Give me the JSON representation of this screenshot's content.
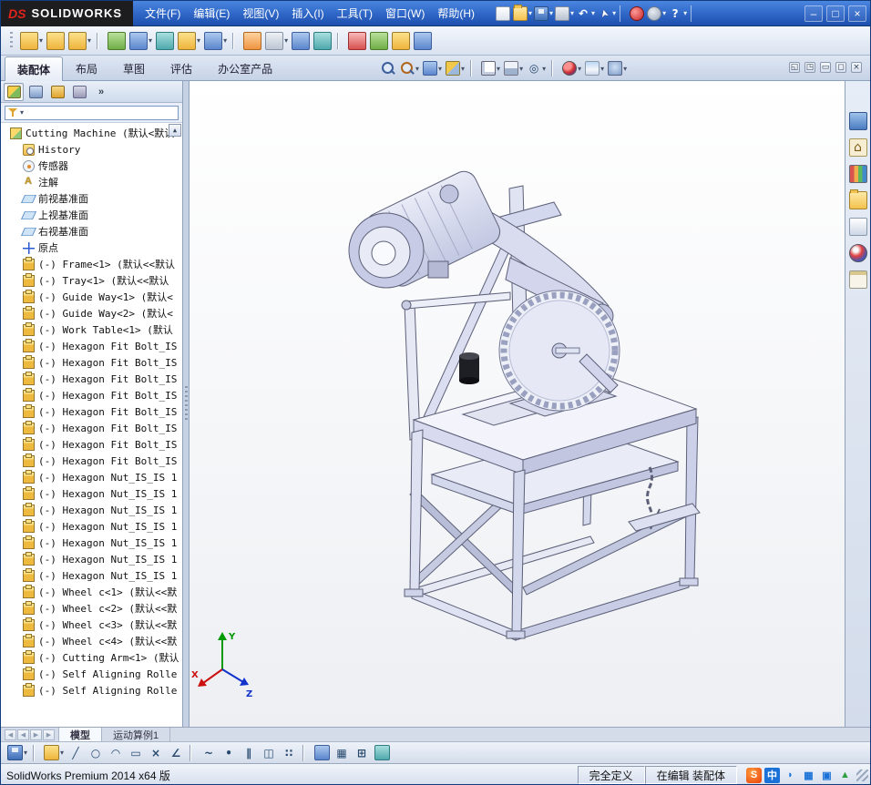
{
  "window": {
    "logo": {
      "ds": "DS",
      "name": "SOLIDWORKS"
    },
    "menus": [
      {
        "label": "文件(F)",
        "name": "menu-file"
      },
      {
        "label": "编辑(E)",
        "name": "menu-edit"
      },
      {
        "label": "视图(V)",
        "name": "menu-view"
      },
      {
        "label": "插入(I)",
        "name": "menu-insert"
      },
      {
        "label": "工具(T)",
        "name": "menu-tools"
      },
      {
        "label": "窗口(W)",
        "name": "menu-window"
      },
      {
        "label": "帮助(H)",
        "name": "menu-help"
      }
    ],
    "controls": [
      {
        "glyph": "–",
        "name": "minimize-button"
      },
      {
        "glyph": "□",
        "name": "maximize-button"
      },
      {
        "glyph": "×",
        "name": "close-button"
      }
    ]
  },
  "titlebar_tools": {
    "items": [
      {
        "kind": "doc",
        "name": "new-document-icon"
      },
      {
        "kind": "folder",
        "name": "open-document-icon",
        "caret": true
      },
      {
        "kind": "save",
        "name": "save-icon",
        "caret": true
      },
      {
        "kind": "print",
        "name": "print-icon",
        "caret": true
      },
      {
        "kind": "undo",
        "name": "undo-icon",
        "glyph": "↶",
        "caret": true
      },
      {
        "kind": "cursor",
        "name": "select-icon",
        "glyph": "➤",
        "caret": true
      },
      {
        "kind": "sep",
        "name": "separator",
        "inter": "false"
      },
      {
        "kind": "rebuild",
        "name": "rebuild-icon"
      },
      {
        "kind": "gear",
        "name": "options-icon",
        "caret": true
      },
      {
        "kind": "help",
        "name": "help-icon",
        "glyph": "?",
        "caret": true
      },
      {
        "kind": "sep",
        "name": "separator",
        "inter": "false"
      }
    ]
  },
  "toolbar2": {
    "items": [
      {
        "kind": "k-gold",
        "name": "insert-components-icon",
        "caret": true
      },
      {
        "kind": "k-gold",
        "name": "mate-icon"
      },
      {
        "kind": "k-gold",
        "name": "linear-component-pattern-icon",
        "caret": true
      },
      {
        "kind": "sep",
        "name": "separator",
        "inter": "false"
      },
      {
        "kind": "k-green",
        "name": "smart-fasteners-icon"
      },
      {
        "kind": "k-blue",
        "name": "move-component-icon",
        "caret": true
      },
      {
        "kind": "k-teal",
        "name": "show-hidden-components-icon"
      },
      {
        "kind": "k-gold",
        "name": "assembly-features-icon",
        "caret": true
      },
      {
        "kind": "k-blue",
        "name": "reference-geometry-icon",
        "caret": true
      },
      {
        "kind": "sep",
        "name": "separator",
        "inter": "false"
      },
      {
        "kind": "k-orange",
        "name": "new-motion-study-icon"
      },
      {
        "kind": "k-gray",
        "name": "bill-of-materials-icon",
        "caret": true
      },
      {
        "kind": "k-blue",
        "name": "exploded-view-icon"
      },
      {
        "kind": "k-teal",
        "name": "explode-line-sketch-icon"
      },
      {
        "kind": "sep",
        "name": "separator",
        "inter": "false"
      },
      {
        "kind": "k-red",
        "name": "interference-detection-icon"
      },
      {
        "kind": "k-green",
        "name": "assembly-xpert-icon"
      },
      {
        "kind": "k-gold",
        "name": "take-snapshot-icon"
      },
      {
        "kind": "k-blue",
        "name": "instant3d-icon"
      }
    ]
  },
  "command_tabs": {
    "items": [
      {
        "label": "装配体",
        "name": "tab-assembly",
        "active": "true"
      },
      {
        "label": "布局",
        "name": "tab-layout",
        "active": "false"
      },
      {
        "label": "草图",
        "name": "tab-sketch",
        "active": "false"
      },
      {
        "label": "评估",
        "name": "tab-evaluate",
        "active": "false"
      },
      {
        "label": "办公室产品",
        "name": "tab-office-products",
        "active": "false"
      }
    ]
  },
  "headsup": {
    "items": [
      {
        "kind": "mag",
        "name": "zoom-to-fit-icon"
      },
      {
        "kind": "magarea",
        "name": "zoom-to-area-icon",
        "caret": true
      },
      {
        "kind": "k-blue",
        "name": "previous-view-icon",
        "caret": true
      },
      {
        "kind": "section",
        "name": "section-view-icon",
        "caret": true
      },
      {
        "kind": "sep",
        "name": "separator",
        "inter": "false"
      },
      {
        "kind": "orient",
        "name": "view-orientation-icon",
        "caret": true
      },
      {
        "kind": "dstyle",
        "name": "display-style-icon",
        "caret": true
      },
      {
        "kind": "plain",
        "glyph": "◎",
        "name": "hide-show-items-icon",
        "caret": true
      },
      {
        "kind": "sep",
        "name": "separator",
        "inter": "false"
      },
      {
        "kind": "ball",
        "name": "edit-appearance-icon",
        "caret": true
      },
      {
        "kind": "scene",
        "name": "apply-scene-icon",
        "caret": true
      },
      {
        "kind": "vset",
        "name": "view-settings-icon",
        "caret": true
      }
    ]
  },
  "dock": {
    "items": [
      {
        "kind": "mini",
        "glyph": "◱",
        "name": "dock-pane-left-icon"
      },
      {
        "kind": "mini",
        "glyph": "◳",
        "name": "dock-pane-right-icon"
      },
      {
        "kind": "mini",
        "glyph": "▭",
        "name": "collapse-commandmanager-icon"
      },
      {
        "kind": "mini",
        "glyph": "◻",
        "name": "float-commandmanager-icon"
      },
      {
        "kind": "mini",
        "glyph": "×",
        "name": "close-commandmanager-icon"
      }
    ]
  },
  "panel": {
    "tabs": {
      "items": [
        {
          "kind": "pt-feature",
          "name": "featuremanager-tab",
          "active": "true"
        },
        {
          "kind": "pt-property",
          "name": "propertymanager-tab",
          "active": "false"
        },
        {
          "kind": "pt-config",
          "name": "configurationmanager-tab",
          "active": "false"
        },
        {
          "kind": "pt-dimxpert",
          "name": "dimxpertmanager-tab",
          "active": "false"
        }
      ]
    },
    "more_glyph": "»",
    "scroll_up_glyph": "▲",
    "tree": {
      "root": {
        "label": "Cutting Machine (默认<默认",
        "icon": "assembly-icon"
      },
      "items": [
        {
          "icon": "history-icon",
          "label": "History"
        },
        {
          "icon": "sensors-icon",
          "label": "传感器"
        },
        {
          "icon": "annotations-icon",
          "label": "注解"
        },
        {
          "icon": "plane-icon",
          "label": "前视基准面"
        },
        {
          "icon": "plane-icon",
          "label": "上视基准面"
        },
        {
          "icon": "plane-icon",
          "label": "右视基准面"
        },
        {
          "icon": "origin-icon",
          "label": "原点"
        },
        {
          "icon": "part-icon",
          "label": "(-) Frame<1> (默认<<默认"
        },
        {
          "icon": "part-icon",
          "label": "(-) Tray<1> (默认<<默认"
        },
        {
          "icon": "part-icon",
          "label": "(-) Guide Way<1> (默认<"
        },
        {
          "icon": "part-icon",
          "label": "(-) Guide Way<2> (默认<"
        },
        {
          "icon": "part-icon",
          "label": "(-) Work Table<1> (默认"
        },
        {
          "icon": "part-icon",
          "label": "(-) Hexagon Fit Bolt_IS"
        },
        {
          "icon": "part-icon",
          "label": "(-) Hexagon Fit Bolt_IS"
        },
        {
          "icon": "part-icon",
          "label": "(-) Hexagon Fit Bolt_IS"
        },
        {
          "icon": "part-icon",
          "label": "(-) Hexagon Fit Bolt_IS"
        },
        {
          "icon": "part-icon",
          "label": "(-) Hexagon Fit Bolt_IS"
        },
        {
          "icon": "part-icon",
          "label": "(-) Hexagon Fit Bolt_IS"
        },
        {
          "icon": "part-icon",
          "label": "(-) Hexagon Fit Bolt_IS"
        },
        {
          "icon": "part-icon",
          "label": "(-) Hexagon Fit Bolt_IS"
        },
        {
          "icon": "part-icon",
          "label": "(-) Hexagon Nut_IS_IS 1"
        },
        {
          "icon": "part-icon",
          "label": "(-) Hexagon Nut_IS_IS 1"
        },
        {
          "icon": "part-icon",
          "label": "(-) Hexagon Nut_IS_IS 1"
        },
        {
          "icon": "part-icon",
          "label": "(-) Hexagon Nut_IS_IS 1"
        },
        {
          "icon": "part-icon",
          "label": "(-) Hexagon Nut_IS_IS 1"
        },
        {
          "icon": "part-icon",
          "label": "(-) Hexagon Nut_IS_IS 1"
        },
        {
          "icon": "part-icon",
          "label": "(-) Hexagon Nut_IS_IS 1"
        },
        {
          "icon": "part-icon",
          "label": "(-) Wheel c<1> (默认<<默"
        },
        {
          "icon": "part-icon",
          "label": "(-) Wheel c<2> (默认<<默"
        },
        {
          "icon": "part-icon",
          "label": "(-) Wheel c<3> (默认<<默"
        },
        {
          "icon": "part-icon",
          "label": "(-) Wheel c<4> (默认<<默"
        },
        {
          "icon": "part-icon",
          "label": "(-) Cutting Arm<1> (默认"
        },
        {
          "icon": "part-icon",
          "label": "(-) Self Aligning Rolle"
        },
        {
          "icon": "part-icon",
          "label": "(-) Self Aligning Rolle"
        }
      ]
    }
  },
  "viewport": {
    "triad": {
      "x": "X",
      "y": "Y",
      "z": "Z"
    }
  },
  "taskpane": {
    "items": [
      {
        "kind": "tp-res",
        "name": "solidworks-resources-icon"
      },
      {
        "kind": "tp-home",
        "name": "home-icon",
        "glyph": "⌂"
      },
      {
        "kind": "tp-lib",
        "name": "design-library-icon"
      },
      {
        "kind": "tp-folder",
        "name": "file-explorer-icon"
      },
      {
        "kind": "tp-pal",
        "name": "view-palette-icon"
      },
      {
        "kind": "tp-ball",
        "name": "appearances-icon"
      },
      {
        "kind": "tp-form",
        "name": "custom-properties-icon"
      }
    ]
  },
  "bottom_tabs": {
    "nav": {
      "items": [
        {
          "glyph": "◀",
          "name": "scroll-first-button"
        },
        {
          "glyph": "◀",
          "name": "scroll-prev-button"
        },
        {
          "glyph": "▶",
          "name": "scroll-next-button"
        },
        {
          "glyph": "▶",
          "name": "scroll-last-button"
        }
      ]
    },
    "items": [
      {
        "label": "模型",
        "name": "tab-model",
        "active": "true"
      },
      {
        "label": "运动算例1",
        "name": "tab-motion-study-1",
        "active": "false"
      }
    ]
  },
  "sketchbar": {
    "items": [
      {
        "kind": "save",
        "name": "save-icon",
        "caret": true
      },
      {
        "kind": "sep",
        "name": "separator",
        "inter": "false"
      },
      {
        "kind": "k-gold",
        "name": "sketch-icon",
        "caret": true
      },
      {
        "kind": "plain",
        "glyph": "╱",
        "name": "line-icon"
      },
      {
        "kind": "plain",
        "glyph": "○",
        "name": "circle-icon"
      },
      {
        "kind": "plain",
        "glyph": "◠",
        "name": "arc-icon"
      },
      {
        "kind": "plain",
        "glyph": "▭",
        "name": "rectangle-icon"
      },
      {
        "kind": "plain",
        "glyph": "×",
        "name": "trim-entities-icon"
      },
      {
        "kind": "plain",
        "glyph": "∠",
        "name": "sketch-chamfer-icon"
      },
      {
        "kind": "sep",
        "name": "separator",
        "inter": "false"
      },
      {
        "kind": "plain",
        "glyph": "~",
        "name": "spline-icon"
      },
      {
        "kind": "plain",
        "glyph": "•",
        "name": "point-icon"
      },
      {
        "kind": "plain",
        "glyph": "∥",
        "name": "offset-entities-icon"
      },
      {
        "kind": "plain",
        "glyph": "◫",
        "name": "mirror-entities-icon"
      },
      {
        "kind": "plain",
        "glyph": "∷",
        "name": "linear-sketch-pattern-icon"
      },
      {
        "kind": "sep",
        "name": "separator",
        "inter": "false"
      },
      {
        "kind": "k-blue",
        "name": "grid-settings-icon"
      },
      {
        "kind": "plain",
        "glyph": "▦",
        "name": "grid-snap-icon"
      },
      {
        "kind": "plain",
        "glyph": "⊞",
        "name": "quick-snaps-icon"
      },
      {
        "kind": "k-teal",
        "name": "shaded-sketch-contours-icon"
      }
    ]
  },
  "statusbar": {
    "left": "SolidWorks Premium 2014 x64 版",
    "cells": [
      {
        "label": "完全定义",
        "name": "status-fully-defined"
      },
      {
        "label": "在编辑 装配体",
        "name": "status-editing-assembly"
      }
    ],
    "tray": {
      "items": [
        {
          "glyph": "S",
          "kind": "tray-sogou",
          "name": "sogou-input-icon"
        },
        {
          "glyph": "中",
          "kind": "tray-zh",
          "name": "chinese-mode-icon"
        },
        {
          "glyph": "◗",
          "kind": "tray-blue",
          "name": "ime-crescent-icon"
        },
        {
          "glyph": "▦",
          "kind": "tray-blue",
          "name": "ime-keyboard-icon"
        },
        {
          "glyph": "▣",
          "kind": "tray-blue",
          "name": "ime-toolbox-icon"
        },
        {
          "glyph": "▲",
          "kind": "tray-green",
          "name": "tray-more-icon"
        }
      ]
    }
  }
}
